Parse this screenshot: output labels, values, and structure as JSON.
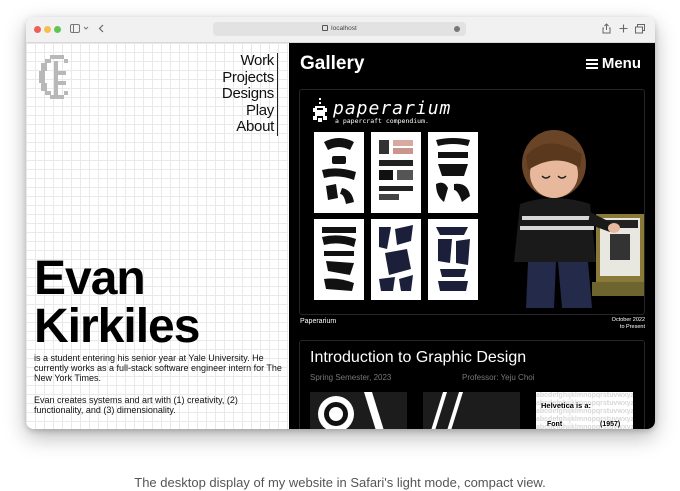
{
  "browser": {
    "url": "localhost"
  },
  "site": {
    "nav": [
      "Work",
      "Projects",
      "Designs",
      "Play",
      "About"
    ],
    "name_line1": "Evan",
    "name_line2": "Kirkiles",
    "bio1": "is a student entering his senior year at Yale University. He currently works as a full-stack software engineer intern for The New York Times.",
    "bio2": "Evan creates systems and art with (1) creativity, (2) functionality, and (3) dimensionality."
  },
  "gallery": {
    "title": "Gallery",
    "menu_label": "Menu",
    "card1": {
      "heading": "paperarium",
      "subheading": "a papercraft compendium.",
      "label": "Paperarium",
      "date_line1": "October 2022",
      "date_line2": "to Present"
    },
    "card2": {
      "title": "Introduction to Graphic Design",
      "semester": "Spring Semester, 2023",
      "professor": "Professor: Yeju Choi",
      "thumb3_line1": "Helvetica is a:",
      "thumb3_word": "Font",
      "thumb3_year": "(1957)"
    }
  },
  "caption": "The desktop display of my website in Safari's light mode, compact view.",
  "colors": {
    "accent_dark": "#000000",
    "grid_line": "#e9e9e9"
  }
}
